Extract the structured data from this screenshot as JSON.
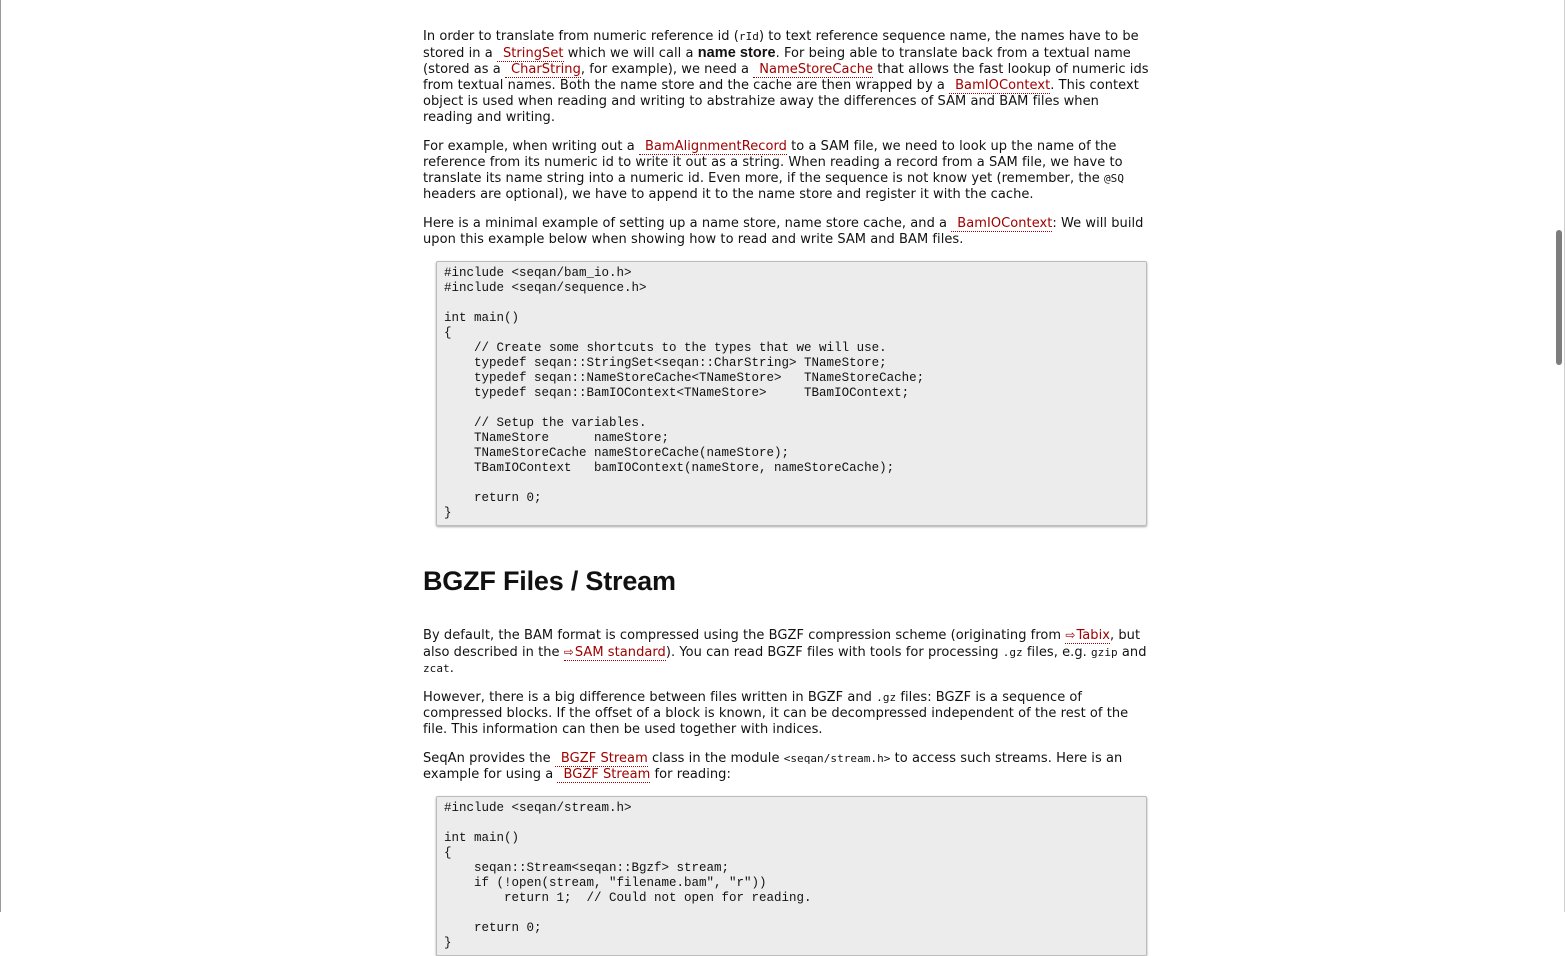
{
  "sec1": {
    "p1": {
      "t1": "In order to translate from numeric reference id (",
      "c1": "rId",
      "t2": ") to text reference sequence name, the names have to be stored in a",
      "l1": "StringSet",
      "t3": " which we will call a ",
      "b1": "name store",
      "t4": ". For being able to translate back from a textual name (stored as a",
      "l2": "CharString",
      "t5": ", for example), we need a",
      "l3": "NameStoreCache",
      "t6": " that allows the fast lookup of numeric ids from textual names. Both the name store and the cache are then wrapped by a",
      "l4": "BamIOContext",
      "t7": ". This context object is used when reading and writing to abstrahize away the differences of SAM and BAM files when reading and writing."
    },
    "p2": {
      "t1": "For example, when writing out a",
      "l1": "BamAlignmentRecord",
      "t2": " to a SAM file, we need to look up the name of the reference from its numeric id to write it out as a string. When reading a record from a SAM file, we have to translate its name string into a numeric id. Even more, if the sequence is not know yet (remember, the ",
      "c1": "@SQ",
      "t3": " headers are optional), we have to append it to the name store and register it with the cache."
    },
    "p3": {
      "t1": "Here is a minimal example of setting up a name store, name store cache, and a",
      "l1": "BamIOContext",
      "t2": ": We will build upon this example below when showing how to read and write SAM and BAM files."
    },
    "code": "#include <seqan/bam_io.h>\n#include <seqan/sequence.h>\n\nint main()\n{\n    // Create some shortcuts to the types that we will use.\n    typedef seqan::StringSet<seqan::CharString> TNameStore;\n    typedef seqan::NameStoreCache<TNameStore>   TNameStoreCache;\n    typedef seqan::BamIOContext<TNameStore>     TBamIOContext;\n\n    // Setup the variables.\n    TNameStore      nameStore;\n    TNameStoreCache nameStoreCache(nameStore);\n    TBamIOContext   bamIOContext(nameStore, nameStoreCache);\n\n    return 0;\n}"
  },
  "sec2": {
    "heading": "BGZF Files / Stream",
    "p1": {
      "t1": "By default, the BAM format is compressed using the BGZF compression scheme (originating from ",
      "l1": "Tabix",
      "t2": ", but also described in the ",
      "l2": "SAM standard",
      "t3": "). You can read BGZF files with tools for processing ",
      "c1": ".gz",
      "t4": " files, e.g. ",
      "c2": "gzip",
      "t5": " and ",
      "c3": "zcat",
      "t6": "."
    },
    "p2": {
      "t1": "However, there is a big difference between files written in BGZF and ",
      "c1": ".gz",
      "t2": " files: BGZF is a sequence of compressed blocks. If the offset of a block is known, it can be decompressed independent of the rest of the file. This information can then be used together with indices."
    },
    "p3": {
      "t1": "SeqAn provides the",
      "l1": "BGZF Stream",
      "t2": " class in the module ",
      "c1": "<seqan/stream.h>",
      "t3": " to access such streams. Here is an example for using a",
      "l2": "BGZF Stream",
      "t4": " for reading:"
    },
    "code": "#include <seqan/stream.h>\n\nint main()\n{\n    seqan::Stream<seqan::Bgzf> stream;\n    if (!open(stream, \"filename.bam\", \"r\"))\n        return 1;  // Could not open for reading.\n\n    return 0;\n}"
  },
  "link_arrow": "⇨",
  "colors": {
    "link": "#a10000",
    "code_bg": "#ececec"
  }
}
